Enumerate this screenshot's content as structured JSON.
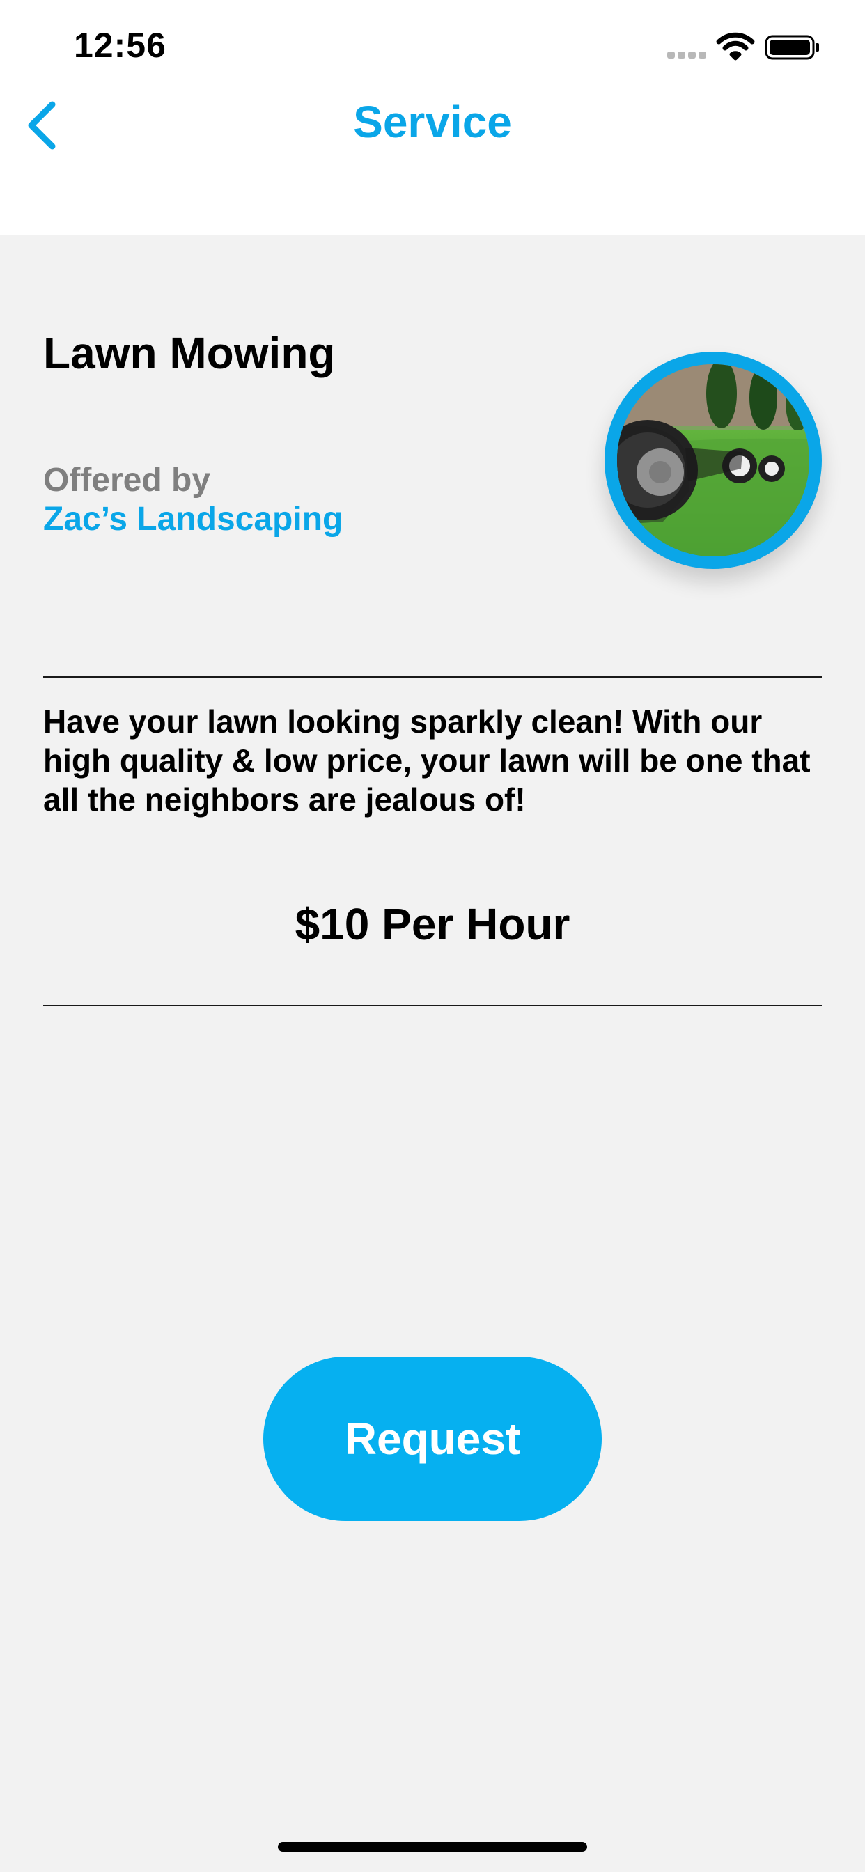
{
  "status_bar": {
    "time": "12:56"
  },
  "nav": {
    "title": "Service",
    "back_icon": "chevron-left-icon"
  },
  "service": {
    "name": "Lawn Mowing",
    "offered_by_label": "Offered by",
    "provider": "Zac’s Landscaping",
    "image_icon": "lawn-mower-photo",
    "description": "Have your lawn looking sparkly clean! With our high quality & low price, your lawn will be one that all the neighbors are jealous of!",
    "price": "$10 Per Hour"
  },
  "actions": {
    "request_label": "Request"
  },
  "colors": {
    "accent": "#0aa6e8",
    "button": "#06b0f0",
    "background": "#f2f2f2",
    "header": "#ffffff"
  }
}
